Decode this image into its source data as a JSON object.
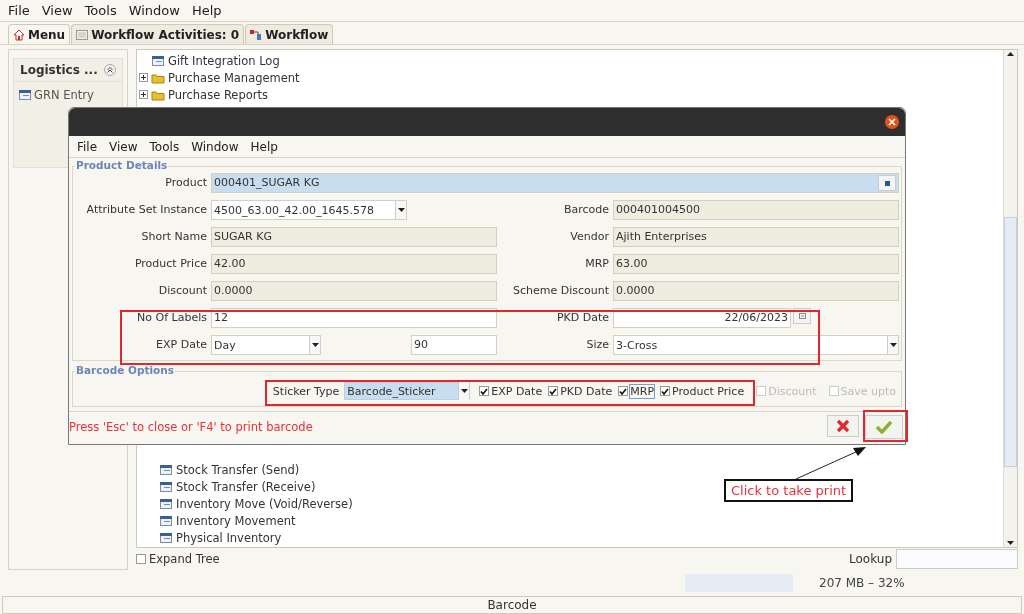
{
  "menu_bar": [
    "File",
    "View",
    "Tools",
    "Window",
    "Help"
  ],
  "tabs": [
    {
      "label": "Menu",
      "selected": true,
      "kind": "home"
    },
    {
      "label": "Workflow Activities: 0",
      "selected": false,
      "kind": "list"
    },
    {
      "label": "Workflow",
      "selected": false,
      "kind": "flow"
    }
  ],
  "sidebar": {
    "title": "Logistics ...",
    "items": [
      {
        "label": "GRN Entry"
      }
    ]
  },
  "tree": {
    "items_top": [
      {
        "label": "Gift Integration Log",
        "kind": "window"
      },
      {
        "label": "Purchase Management",
        "kind": "folder",
        "expanded": false
      },
      {
        "label": "Purchase Reports",
        "kind": "folder",
        "expanded": false
      }
    ],
    "items_bottom": [
      {
        "label": "Stock Transfer (Send)",
        "kind": "window"
      },
      {
        "label": "Stock Transfer (Receive)",
        "kind": "window"
      },
      {
        "label": "Inventory Move (Void/Reverse)",
        "kind": "window"
      },
      {
        "label": "Inventory Movement",
        "kind": "window"
      },
      {
        "label": "Physical Inventory",
        "kind": "window"
      }
    ]
  },
  "expand_tree": {
    "label": "Expand Tree",
    "checked": false
  },
  "lookup": {
    "label": "Lookup"
  },
  "memory": {
    "text": "207 MB – 32%"
  },
  "status_bar": {
    "text": "Barcode"
  },
  "dialog": {
    "menu_bar": [
      "File",
      "View",
      "Tools",
      "Window",
      "Help"
    ],
    "product_details": {
      "legend": "Product Details",
      "rows": [
        [
          {
            "label": "Product",
            "value": "000401_SUGAR KG",
            "kind": "lookup"
          }
        ],
        [
          {
            "label": "Attribute Set Instance",
            "value": "4500_63.00_42.00_1645.578",
            "kind": "combo_short"
          },
          {
            "label": "Barcode",
            "value": "000401004500",
            "kind": "readonly"
          }
        ],
        [
          {
            "label": "Short Name",
            "value": "SUGAR KG",
            "kind": "readonly"
          },
          {
            "label": "Vendor",
            "value": "Ajith Enterprises",
            "kind": "readonly"
          }
        ],
        [
          {
            "label": "Product Price",
            "value": "42.00",
            "kind": "readonly"
          },
          {
            "label": "MRP",
            "value": "63.00",
            "kind": "readonly"
          }
        ],
        [
          {
            "label": "Discount",
            "value": "0.0000",
            "kind": "readonly"
          },
          {
            "label": "Scheme Discount",
            "value": "0.0000",
            "kind": "readonly"
          }
        ],
        [
          {
            "label": "No Of Labels",
            "value": "12",
            "kind": "text"
          },
          {
            "label": "PKD Date",
            "value": "22/06/2023",
            "kind": "date"
          }
        ],
        [
          {
            "label": "EXP Date",
            "value": "Day",
            "extra": "90",
            "kind": "combo_number"
          },
          {
            "label": "Size",
            "value": "3-Cross",
            "kind": "combo"
          }
        ]
      ]
    },
    "barcode_options": {
      "legend": "Barcode Options",
      "sticker_type": {
        "label": "Sticker Type",
        "value": "Barcode_Sticker"
      },
      "options": [
        {
          "label": "EXP Date",
          "checked": true,
          "disabled": false,
          "focused": false
        },
        {
          "label": "PKD Date",
          "checked": true,
          "disabled": false,
          "focused": false
        },
        {
          "label": "MRP",
          "checked": true,
          "disabled": false,
          "focused": true
        },
        {
          "label": "Product Price",
          "checked": true,
          "disabled": false,
          "focused": false
        },
        {
          "label": "Discount",
          "checked": false,
          "disabled": true,
          "focused": false
        },
        {
          "label": "Save upto",
          "checked": false,
          "disabled": true,
          "focused": false
        }
      ]
    },
    "hint": "Press 'Esc' to close or 'F4' to print barcode",
    "buttons": [
      {
        "kind": "cancel"
      },
      {
        "kind": "ok"
      }
    ]
  },
  "callout": {
    "text": "Click to take print"
  }
}
